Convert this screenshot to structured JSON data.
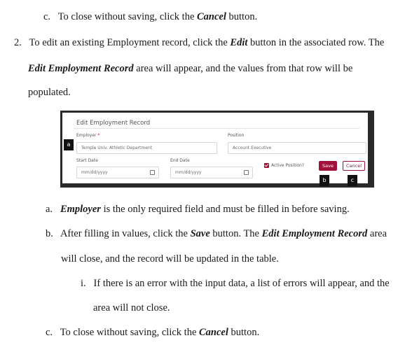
{
  "doc": {
    "line1": {
      "marker": "c.",
      "pre": "To close without saving, click the ",
      "em": "Cancel",
      "post": " button."
    },
    "item2": {
      "marker": "2.",
      "l1_pre": "To edit an existing Employment record, click the ",
      "l1_em": "Edit",
      "l1_post": " button in the associated row. The",
      "l2_em": "Edit Employment Record",
      "l2_post": " area will appear, and the values from that row will be",
      "l3": "populated."
    },
    "sub_a": {
      "marker": "a.",
      "em": "Employer",
      "post": " is the only required field and must be filled in before saving."
    },
    "sub_b": {
      "marker": "b.",
      "l1_pre": "After filling in values, click the ",
      "l1_em1": "Save",
      "l1_mid": " button. The ",
      "l1_em2": "Edit Employment Record",
      "l1_post": " area",
      "l2": "will close, and the record will be updated in the table."
    },
    "sub_b_i": {
      "marker": "i.",
      "l1": "If there is an error with the input data, a list of errors will appear, and the",
      "l2": "area will not close."
    },
    "sub_c": {
      "marker": "c.",
      "pre": "To close without saving, click the ",
      "em": "Cancel",
      "post": " button."
    }
  },
  "screenshot": {
    "title": "Edit Employment Record",
    "employer_label": "Employer",
    "required_mark": "*",
    "employer_value": "Temple Univ. Athletic Department",
    "position_label": "Position",
    "position_value": "Account Executive",
    "start_label": "Start Date",
    "start_placeholder": "mm/dd/yyyy",
    "end_label": "End Date",
    "end_placeholder": "mm/dd/yyyy",
    "active_label": "Active Position?",
    "save_label": "Save",
    "cancel_label": "Cancel",
    "callout_a": "a",
    "callout_b": "b",
    "callout_c": "c"
  }
}
